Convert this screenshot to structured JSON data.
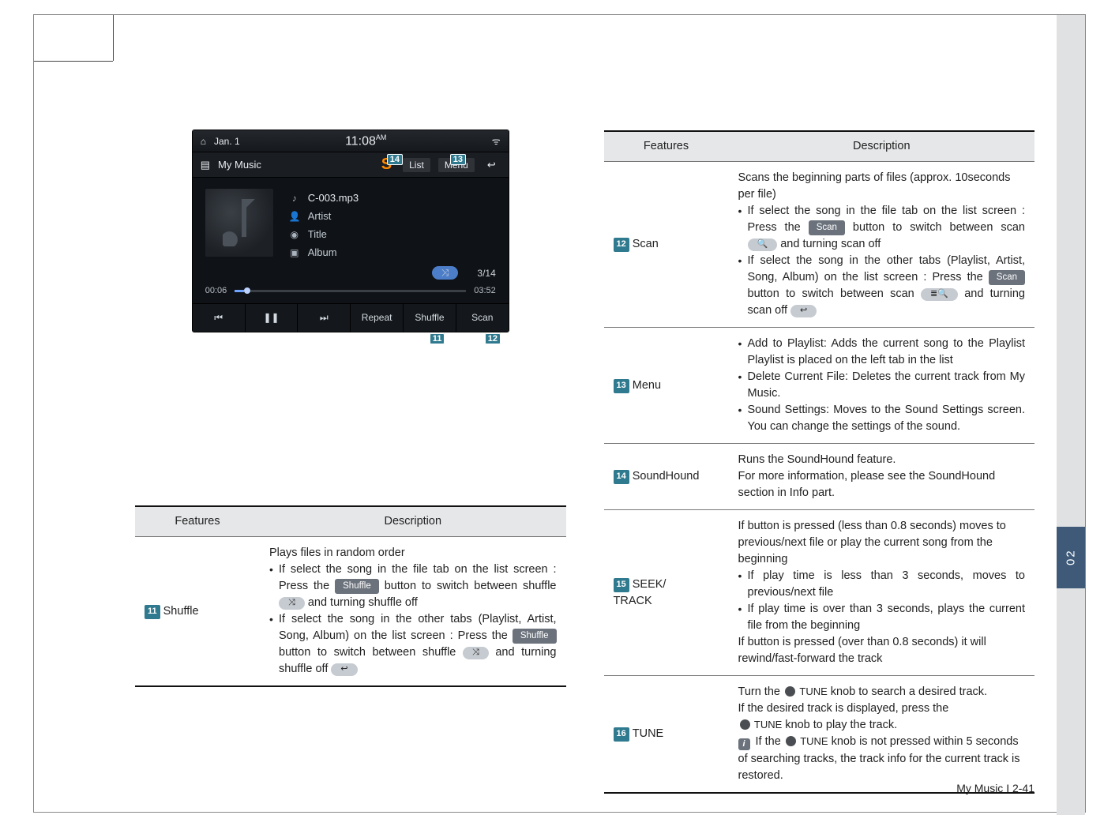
{
  "side_tab": {
    "label": "02"
  },
  "screenshot": {
    "date": "Jan.  1",
    "time": "11:08",
    "time_suffix": "AM",
    "source": "My Music",
    "list_label": "List",
    "menu_label": "Menu",
    "file_name": "C-003.mp3",
    "artist_label": "Artist",
    "title_label": "Title",
    "album_label": "Album",
    "track_counter": "3/14",
    "elapsed": "00:06",
    "total": "03:52",
    "buttons": {
      "prev": "⏮",
      "pause": "❚❚",
      "next": "⏭",
      "repeat": "Repeat",
      "shuffle": "Shuffle",
      "scan": "Scan"
    },
    "callouts": {
      "soundhound": "14",
      "menu": "13",
      "shuffle": "11",
      "scan": "12"
    }
  },
  "table_left": {
    "head_features": "Features",
    "head_desc": "Description",
    "rows": [
      {
        "num": "11",
        "name": "Shuffle",
        "desc_lead": "Plays files in random order",
        "bullets": [
          {
            "pre": "If select the song in the file tab on the list screen : Press the ",
            "chip": "Shuffle",
            "post1": " button to switch between shuffle ",
            "icon1": "⤨",
            "post2": " and turning shuffle off"
          },
          {
            "pre": "If select the song in the other tabs (Playlist, Artist, Song, Album) on the list screen :  Press the ",
            "chip": "Shuffle",
            "post1": " button to switch between shuffle ",
            "icon1": "⤨",
            "post2": " and turning shuffle off ",
            "icon2": "↩"
          }
        ]
      }
    ]
  },
  "table_right": {
    "head_features": "Features",
    "head_desc": "Description",
    "rows": [
      {
        "num": "12",
        "name": "Scan",
        "desc_lead": "Scans the beginning parts of files (approx. 10seconds per file)",
        "bullets": [
          {
            "pre": "If select the song in the file tab on the list screen : Press the ",
            "chip": "Scan",
            "post1": " button to switch between scan ",
            "icon1": "🔍",
            "post2": " and turning scan off"
          },
          {
            "pre": "If select the song in the other tabs (Playlist, Artist, Song, Album) on the list screen : Press the ",
            "chip": "Scan",
            "post1": " button to switch between scan ",
            "icon1": "≣🔍",
            "post2": " and turning scan off ",
            "icon2": "↩"
          }
        ]
      },
      {
        "num": "13",
        "name": "Menu",
        "bullets_plain": [
          "Add to Playlist: Adds the current song to the Playlist Playlist is placed on the left tab in the list",
          "Delete Current File: Deletes the current track from My Music.",
          "Sound Settings: Moves to the Sound Settings screen. You can change the settings of the sound."
        ]
      },
      {
        "num": "14",
        "name": "SoundHound",
        "desc_plain": "Runs the SoundHound feature.\nFor more information, please see the SoundHound section in Info part."
      },
      {
        "num": "15",
        "name": "SEEK/\nTRACK",
        "desc_lead": "If button is pressed (less than 0.8 seconds) moves to previous/next file or play the current song from the beginning",
        "bullets_plain": [
          "If play time is less than 3 seconds, moves to previous/next file",
          "If play time is over than 3 seconds, plays the current file from the beginning"
        ],
        "desc_tail": "If button is pressed (over than 0.8 seconds) it will rewind/fast-forward the track"
      },
      {
        "num": "16",
        "name": "TUNE",
        "tune_lines": {
          "l1a": "Turn the ",
          "l1b": " TUNE",
          "l1c": " knob to search a desired track.",
          "l2": "If the desired track is displayed, press the",
          "l3a": " TUNE",
          "l3b": " knob to play the track.",
          "l4a": " If the ",
          "l4b": " TUNE",
          "l4c": " knob is not pressed within 5 seconds of searching tracks, the track info for the current track is restored."
        }
      }
    ]
  },
  "footer": "My Music I 2-41"
}
